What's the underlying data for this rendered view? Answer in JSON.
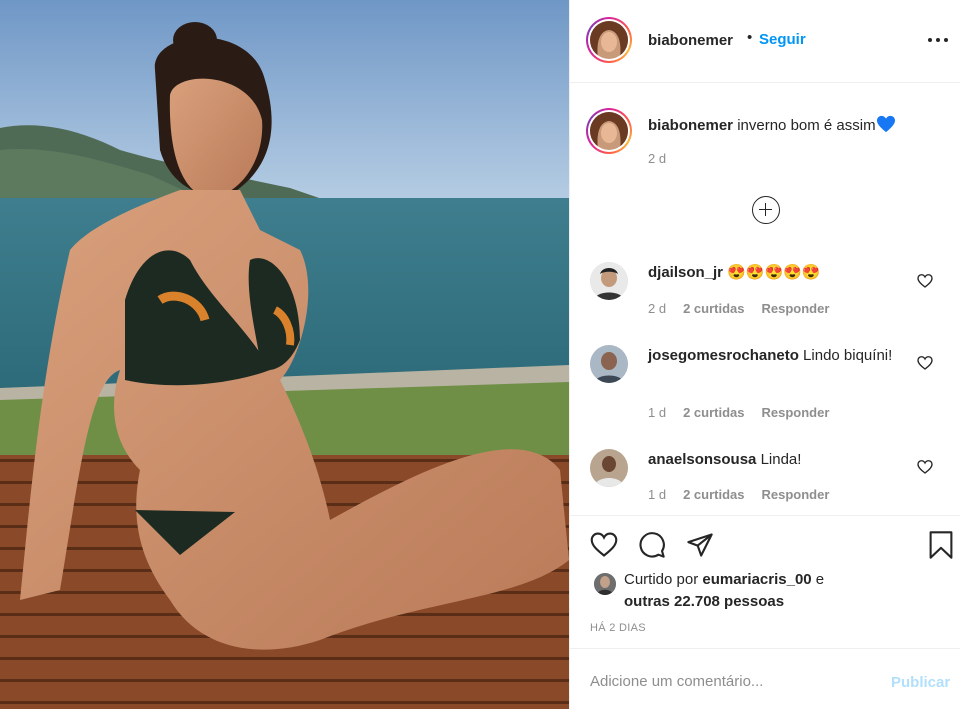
{
  "post": {
    "author": "biabonemer",
    "separator": "•",
    "follow_label": "Seguir",
    "caption_text": "inverno bom é assim",
    "caption_time": "2 d"
  },
  "comments": [
    {
      "username": "djailson_jr",
      "text": "😍😍😍😍😍",
      "time": "2 d",
      "likes": "2 curtidas",
      "reply": "Responder"
    },
    {
      "username": "josegomesrochaneto",
      "text": "Lindo biquíni!",
      "time": "1 d",
      "likes": "2 curtidas",
      "reply": "Responder"
    },
    {
      "username": "anaelsonsousa",
      "text": "Linda!",
      "time": "1 d",
      "likes": "2 curtidas",
      "reply": "Responder"
    }
  ],
  "likes_summary": {
    "prefix": "Curtido por",
    "liker": "eumariacris_00",
    "conjunction": "e",
    "others": "outras 22.708 pessoas"
  },
  "post_date": "HÁ 2 DIAS",
  "comment_box": {
    "placeholder": "Adicione um comentário...",
    "publish_label": "Publicar"
  },
  "colors": {
    "accent": "#0095f6",
    "publish_disabled": "#b2dffc",
    "secondary_text": "#8e8e8e",
    "caption_heart": "#1877f2"
  },
  "icons": [
    "more-options-icon",
    "load-more-comments-icon",
    "like-icon",
    "comment-icon",
    "share-icon",
    "save-icon",
    "blue-heart-icon"
  ]
}
